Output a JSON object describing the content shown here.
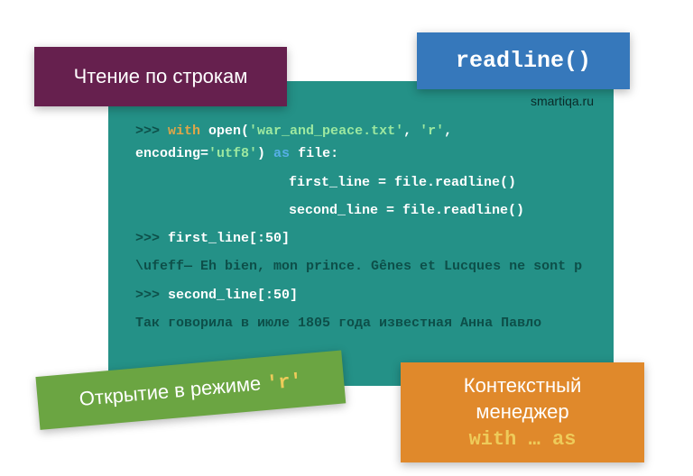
{
  "site": "smartiqa.ru",
  "cards": {
    "purple": "Чтение по строкам",
    "blue": "readline()",
    "green_text": "Открытие в режиме ",
    "green_mono": "'r'",
    "orange_l1": "Контекстный",
    "orange_l2": "менеджер",
    "orange_mono": "with … as"
  },
  "code": {
    "prompt": ">>> ",
    "kw_with": "with",
    "fn_open": " open(",
    "arg1": "'war_and_peace.txt'",
    "comma1": ", ",
    "arg2": "'r'",
    "comma2": ",",
    "enc_key": "encoding=",
    "enc_val": "'utf8'",
    "close_paren": ") ",
    "kw_as": "as",
    "as_tail": " file:",
    "body1": "first_line = file.readline()",
    "body2": "second_line = file.readline()",
    "stmt1": "first_line[:50]",
    "out1": "\\ufeff— Eh bien, mon prince. Gênes et Lucques ne sont p",
    "stmt2": "second_line[:50]",
    "out2": "Так говорила в июле 1805 года известная Анна Павло"
  }
}
